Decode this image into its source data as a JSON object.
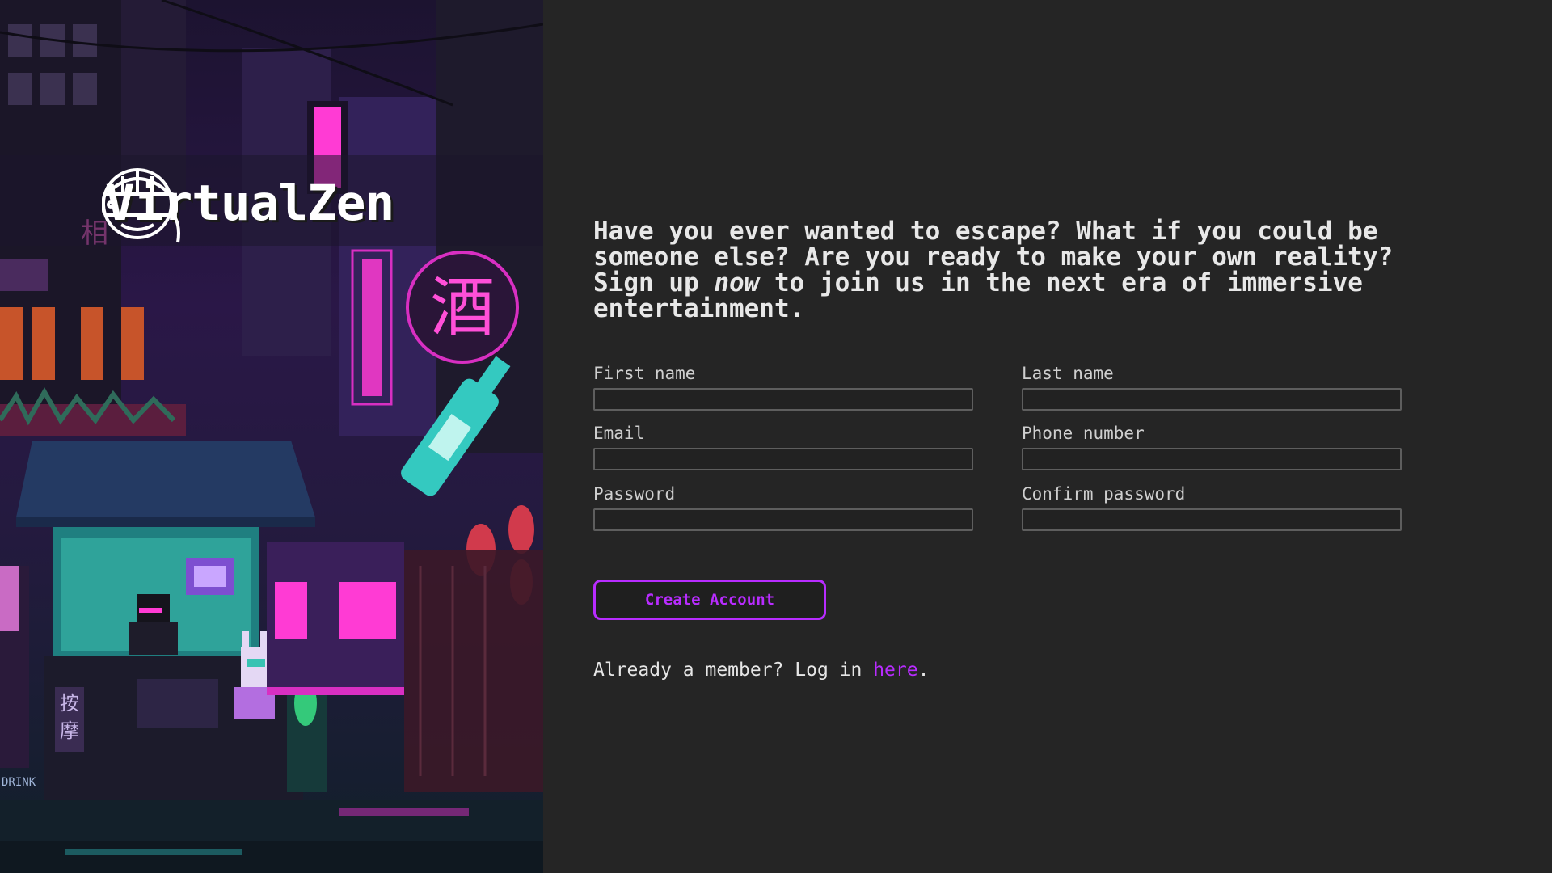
{
  "brand": {
    "name": "VirtualZen"
  },
  "scene": {
    "signs": [
      "酒",
      "相",
      "按",
      "摩",
      "DRINK"
    ]
  },
  "intro": {
    "before": "Have you ever wanted to escape? What if you could be someone else? Are you ready to make your own reality? Sign up ",
    "emphasis": "now",
    "after": " to join us in the next era of immersive entertainment."
  },
  "form": {
    "first_name": {
      "label": "First name",
      "value": ""
    },
    "last_name": {
      "label": "Last name",
      "value": ""
    },
    "email": {
      "label": "Email",
      "value": ""
    },
    "phone": {
      "label": "Phone number",
      "value": ""
    },
    "password": {
      "label": "Password",
      "value": ""
    },
    "confirm_password": {
      "label": "Confirm password",
      "value": ""
    },
    "submit_label": "Create Account"
  },
  "login": {
    "prefix": "Already a member? Log in ",
    "link_text": "here",
    "suffix": "."
  },
  "colors": {
    "page_background": "#252525",
    "accent": "#b82cff",
    "text": "#e8e8e8",
    "input_border": "#5e5e5e"
  }
}
